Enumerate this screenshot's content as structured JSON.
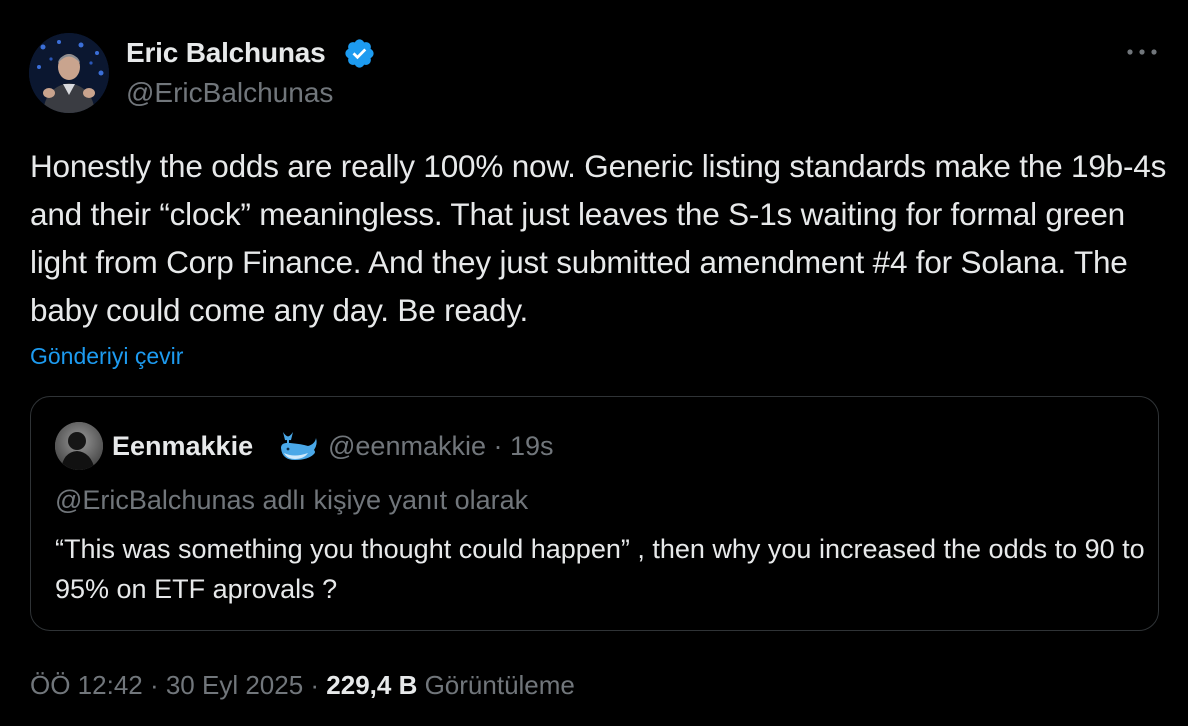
{
  "author": {
    "name": "Eric Balchunas",
    "handle": "@EricBalchunas",
    "avatar_icon": "profile-photo",
    "verified_icon": "verified-badge-icon",
    "verified_color": "#1d9bf0"
  },
  "more_icon": "more-options-icon",
  "tweet": {
    "text": "Honestly the odds are really 100% now. Generic listing standards make the 19b-4s and their “clock” meaningless. That just leaves the S-1s waiting for formal green light from Corp Finance. And they just submitted amendment #4 for Solana. The baby could come any day. Be ready.",
    "translate_label": "Gönderiyi çevir"
  },
  "quote": {
    "name": "Eenmakkie",
    "emoji_icon": "whale-icon",
    "handle_time": "@eenmakkie · 19s",
    "reply_context": "@EricBalchunas adlı kişiye yanıt olarak",
    "text": "“This was something you thought could happen” , then why you increased the odds to 90 to 95% on ETF aprovals ?"
  },
  "meta": {
    "time_date": "ÖÖ 12:42 · 30 Eyl 2025 · ",
    "views_count": "229,4 B",
    "views_label": " Görüntüleme"
  },
  "colors": {
    "background": "#000000",
    "text": "#e7e9ea",
    "secondary": "#71767b",
    "link": "#1d9bf0",
    "border": "#2f3336"
  }
}
